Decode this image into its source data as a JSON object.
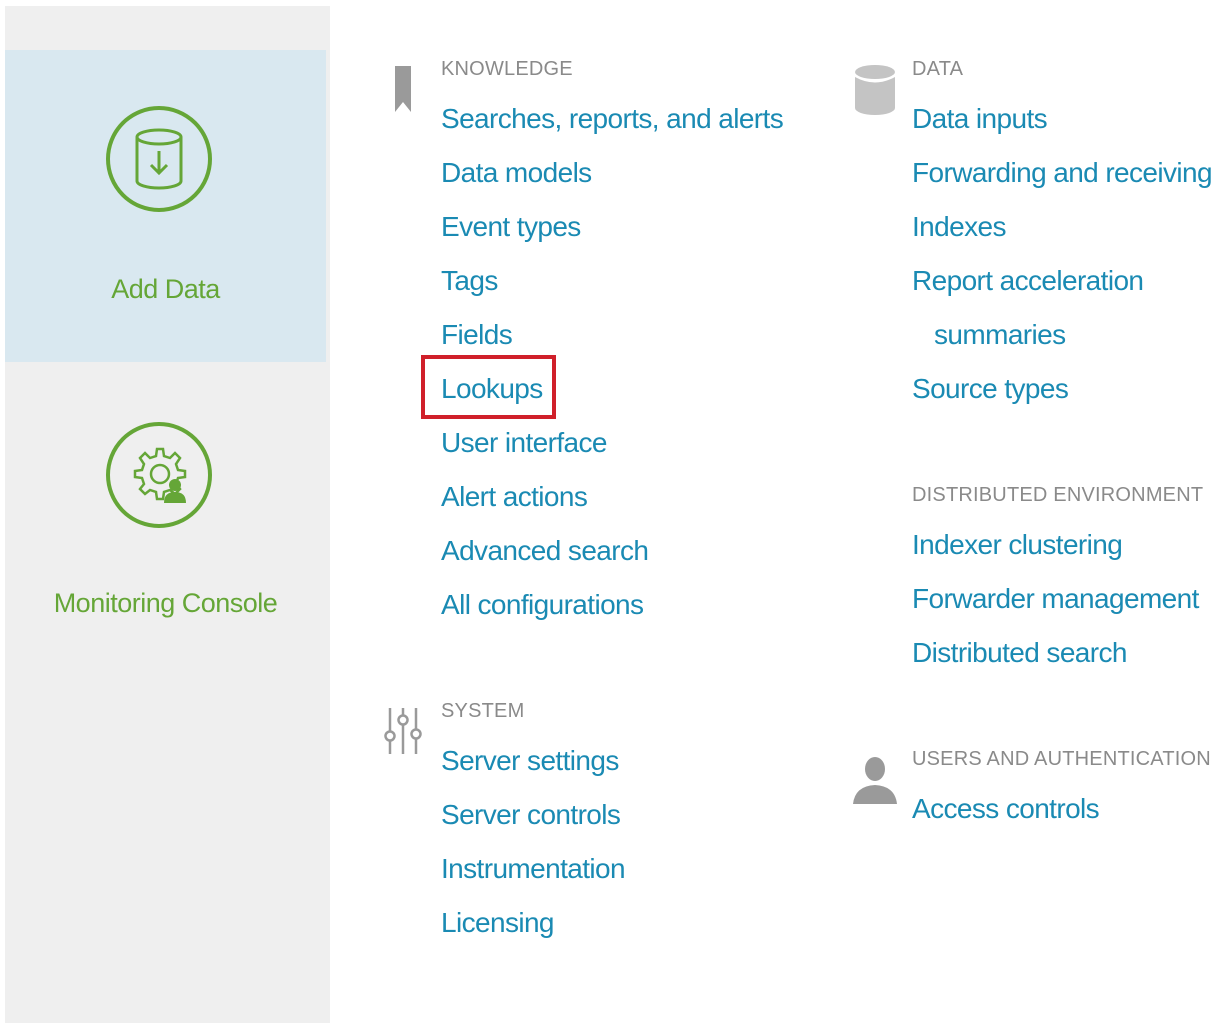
{
  "left_panel": {
    "tiles": [
      {
        "label": "Add Data",
        "icon": "database-download-icon"
      },
      {
        "label": "Monitoring Console",
        "icon": "gear-user-icon"
      }
    ]
  },
  "colors": {
    "link": "#1a8ab3",
    "tile_accent": "#65a637",
    "heading": "#8a8a8a",
    "selected_tile_bg": "#d9e8f0",
    "highlight_border": "#d0202a"
  },
  "sections": {
    "knowledge": {
      "heading": "KNOWLEDGE",
      "icon": "bookmark-icon",
      "links": [
        "Searches, reports, and alerts",
        "Data models",
        "Event types",
        "Tags",
        "Fields",
        "Lookups",
        "User interface",
        "Alert actions",
        "Advanced search",
        "All configurations"
      ]
    },
    "system": {
      "heading": "SYSTEM",
      "icon": "sliders-icon",
      "links": [
        "Server settings",
        "Server controls",
        "Instrumentation",
        "Licensing"
      ]
    },
    "data": {
      "heading": "DATA",
      "icon": "database-icon",
      "links": [
        "Data inputs",
        "Forwarding and receiving",
        "Indexes",
        "Report acceleration",
        "summaries",
        "Source types"
      ]
    },
    "distributed": {
      "heading": "DISTRIBUTED ENVIRONMENT",
      "links": [
        "Indexer clustering",
        "Forwarder management",
        "Distributed search"
      ]
    },
    "users": {
      "heading": "USERS AND AUTHENTICATION",
      "icon": "user-icon",
      "links": [
        "Access controls"
      ]
    }
  }
}
